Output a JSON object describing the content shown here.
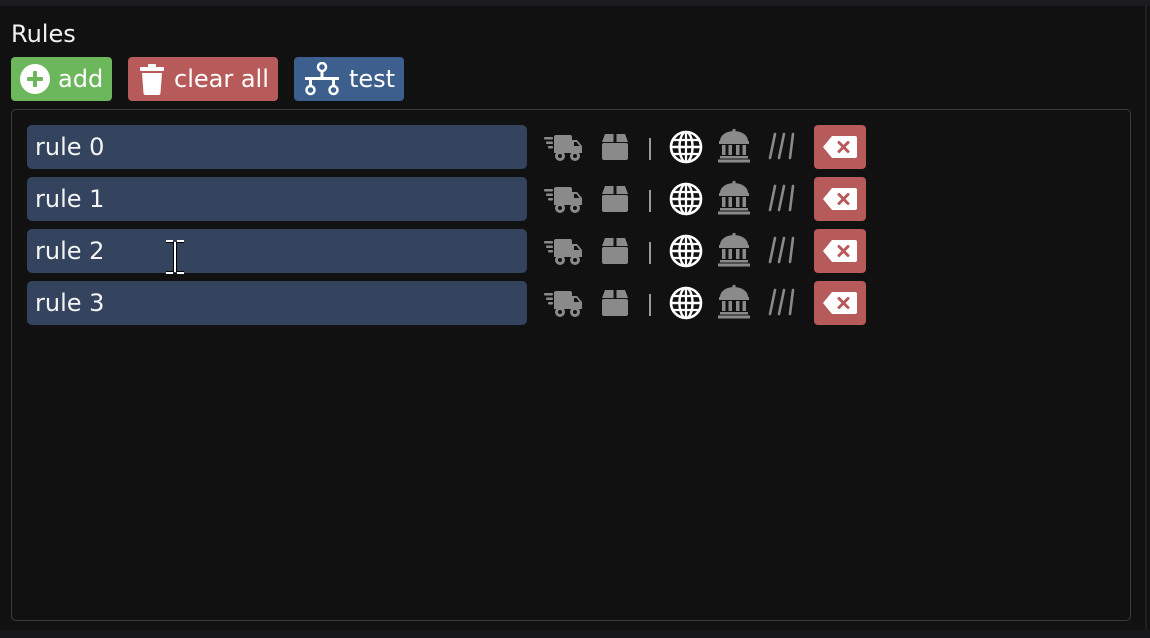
{
  "section": {
    "title": "Rules"
  },
  "toolbar": {
    "add": {
      "label": "add",
      "icon": "plus-circle-icon",
      "color": "#6cb65b"
    },
    "clear": {
      "label": "clear all",
      "icon": "trash-icon",
      "color": "#b75a5a"
    },
    "test": {
      "label": "test",
      "icon": "network-icon",
      "color": "#3d5f8e"
    }
  },
  "rules": [
    {
      "value": "rule 0"
    },
    {
      "value": "rule 1"
    },
    {
      "value": "rule 2"
    },
    {
      "value": "rule 3"
    }
  ],
  "rule_actions": [
    "truck-fast-icon",
    "box-icon",
    "separator",
    "globe-icon",
    "landmark-icon",
    "slashes-icon",
    "delete-button"
  ],
  "colors": {
    "background": "#111111",
    "rule_field": "#34445f",
    "delete": "#b75a5a",
    "icon_muted": "#8a8a8a",
    "icon_active": "#ffffff"
  }
}
